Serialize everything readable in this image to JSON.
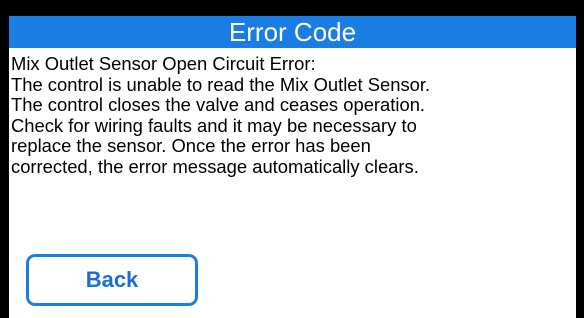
{
  "screen": {
    "title": "Error Code",
    "message_lines": [
      "Mix Outlet Sensor Open Circuit Error:",
      "The control is unable to read the Mix Outlet Sensor.",
      "The control closes the valve and ceases operation.",
      "Check for wiring faults and it may be necessary to",
      "replace the sensor. Once the error has been",
      "corrected, the error message automatically clears."
    ],
    "back_label": "Back"
  },
  "colors": {
    "title_bar": "#1a7de3",
    "button_border": "#1a7de3",
    "button_text": "#1a6fd0",
    "frame": "#000000",
    "panel": "#ffffff"
  }
}
